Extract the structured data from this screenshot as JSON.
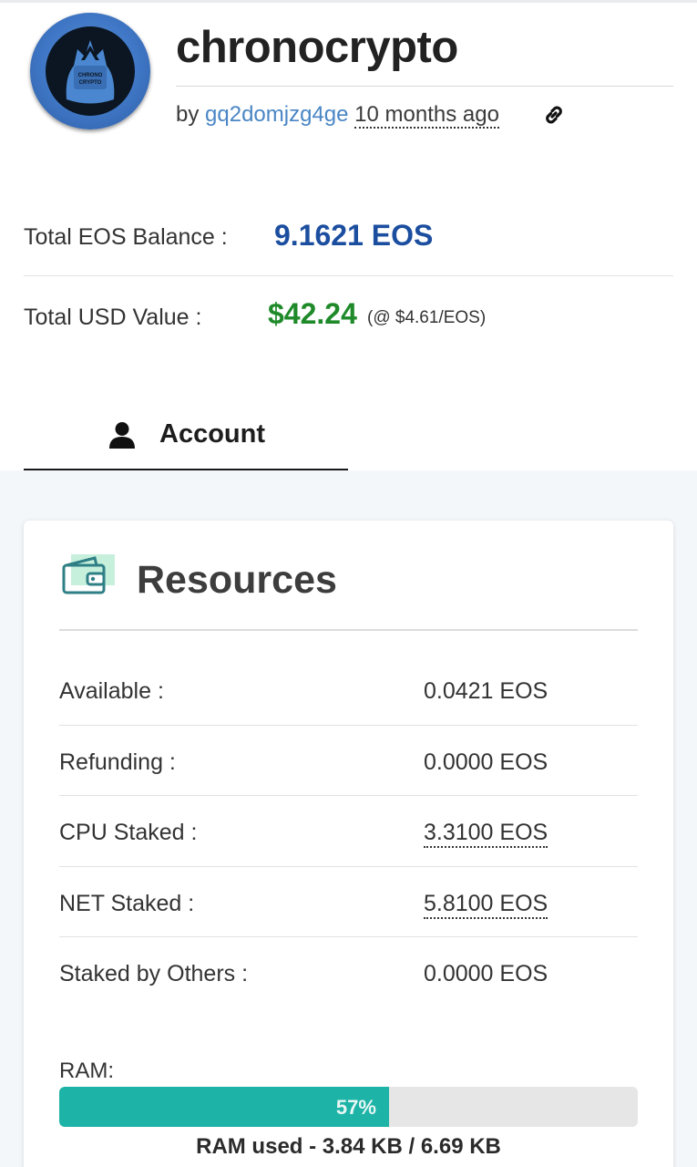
{
  "header": {
    "avatar_text": "CHRONO CRYPTO",
    "account_name": "chronocrypto",
    "by_label": "by",
    "creator": "gq2domjzg4ge",
    "created_ago": "10 months ago",
    "link_icon": "link-icon"
  },
  "balances": {
    "eos_label": "Total EOS Balance :",
    "eos_value": "9.1621 EOS",
    "usd_label": "Total USD Value :",
    "usd_value": "$42.24",
    "usd_rate": "(@ $4.61/EOS)",
    "eos_color": "#1c4ea0",
    "usd_color": "#1f8a2a"
  },
  "tabs": [
    {
      "label": "Account",
      "icon": "user-icon",
      "active": true
    }
  ],
  "resources": {
    "title": "Resources",
    "icon": "wallet-icon",
    "rows": [
      {
        "label": "Available :",
        "value": "0.0421 EOS"
      },
      {
        "label": "Refunding :",
        "value": "0.0000 EOS"
      },
      {
        "label": "CPU Staked :",
        "value": "3.3100 EOS"
      },
      {
        "label": "NET Staked :",
        "value": "5.8100 EOS"
      },
      {
        "label": "Staked by Others :",
        "value": "0.0000 EOS"
      }
    ],
    "ram": {
      "label": "RAM:",
      "percent": 57,
      "percent_text": "57%",
      "used_text": "RAM used - 3.84 KB / 6.69 KB",
      "bar_color": "#1db3a6"
    }
  }
}
